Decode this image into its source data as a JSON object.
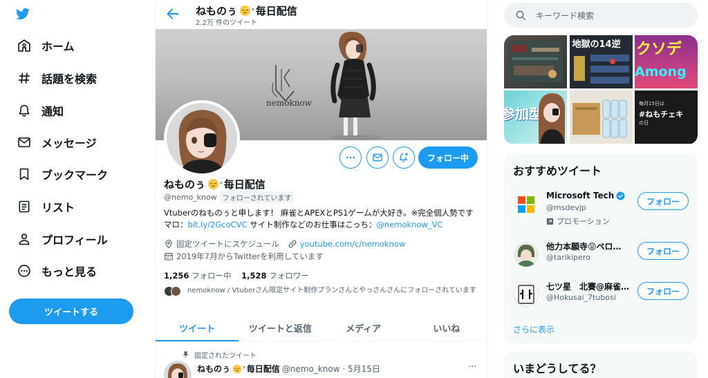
{
  "nav": {
    "items": [
      {
        "label": "ホーム",
        "icon": "home-icon"
      },
      {
        "label": "話題を検索",
        "icon": "hashtag-icon"
      },
      {
        "label": "通知",
        "icon": "bell-icon"
      },
      {
        "label": "メッセージ",
        "icon": "envelope-icon"
      },
      {
        "label": "ブックマーク",
        "icon": "bookmark-icon"
      },
      {
        "label": "リスト",
        "icon": "list-icon"
      },
      {
        "label": "プロフィール",
        "icon": "person-icon"
      },
      {
        "label": "もっと見る",
        "icon": "more-circle-icon"
      }
    ],
    "tweet_button": "ツイートする"
  },
  "header": {
    "name_prefix": "ねものぅ",
    "name_suffix": "毎日配信",
    "tweet_count": "2.2万 件のツイート"
  },
  "banner": {
    "logo_text": "nemoknow"
  },
  "profile": {
    "name_prefix": "ねものぅ",
    "name_suffix": "毎日配信",
    "handle": "@nemo_know",
    "follows_you": "フォローされています",
    "follow_button": "フォロー中",
    "bio_line_pre": "Vtuberのねものぅと申します！ 麻雀とAPEXとPS1ゲームが大好き。※完全個人勢です マロ：",
    "bio_link1": "bit.ly/2GcoCVC",
    "bio_mid": " サイト制作などのお仕事はこっち：",
    "bio_link2": "@nemoknow_VC",
    "location": "固定ツイートにスケジュール",
    "website": "youtube.com/c/nemoknow",
    "joined": "2019年7月からTwitterを利用しています",
    "following_count": "1,256",
    "following_label": "フォロー中",
    "followers_count": "1,528",
    "followers_label": "フォロワー",
    "followed_by": "nemoknow / Vtuberさん限定サイト制作プランさんとやっさんさんにフォローされています"
  },
  "tabs": [
    "ツイート",
    "ツイートと返信",
    "メディア",
    "いいね"
  ],
  "pinned": {
    "label": "固定されたツイート",
    "name_prefix": "ねものぅ",
    "name_suffix": "毎日配信",
    "meta": "@nemo_know · 5月15日",
    "more": "···"
  },
  "search": {
    "placeholder": "キーワード検索"
  },
  "media_tiles": {
    "tile2_text": "地獄の14逆",
    "tile3_text_top": "クソデ",
    "tile3_text_bottom": "Among",
    "tile4_text": "参加型",
    "tile6_text_top": "毎月15日は",
    "tile6_text_main": "#ねもチェキ",
    "tile6_text_sub": "の日"
  },
  "recommended": {
    "title": "おすすめツイート",
    "items": [
      {
        "name": "Microsoft Tech",
        "handle": "@msdevjp",
        "promo": "プロモーション",
        "button": "フォロー"
      },
      {
        "name": "他力本願寺😝ペロ…",
        "handle": "@tarikipero",
        "button": "フォロー"
      },
      {
        "name": "七ツ星　北賽@麻雀…",
        "handle": "@Hokusai_7tubosi",
        "button": "フォロー"
      }
    ],
    "show_more": "さらに表示"
  },
  "whats_happening": {
    "title": "いまどうしてる？"
  },
  "colors": {
    "accent": "#1d9bf0",
    "text": "#0f1419",
    "muted": "#536471",
    "panel": "#f7f9f9"
  }
}
